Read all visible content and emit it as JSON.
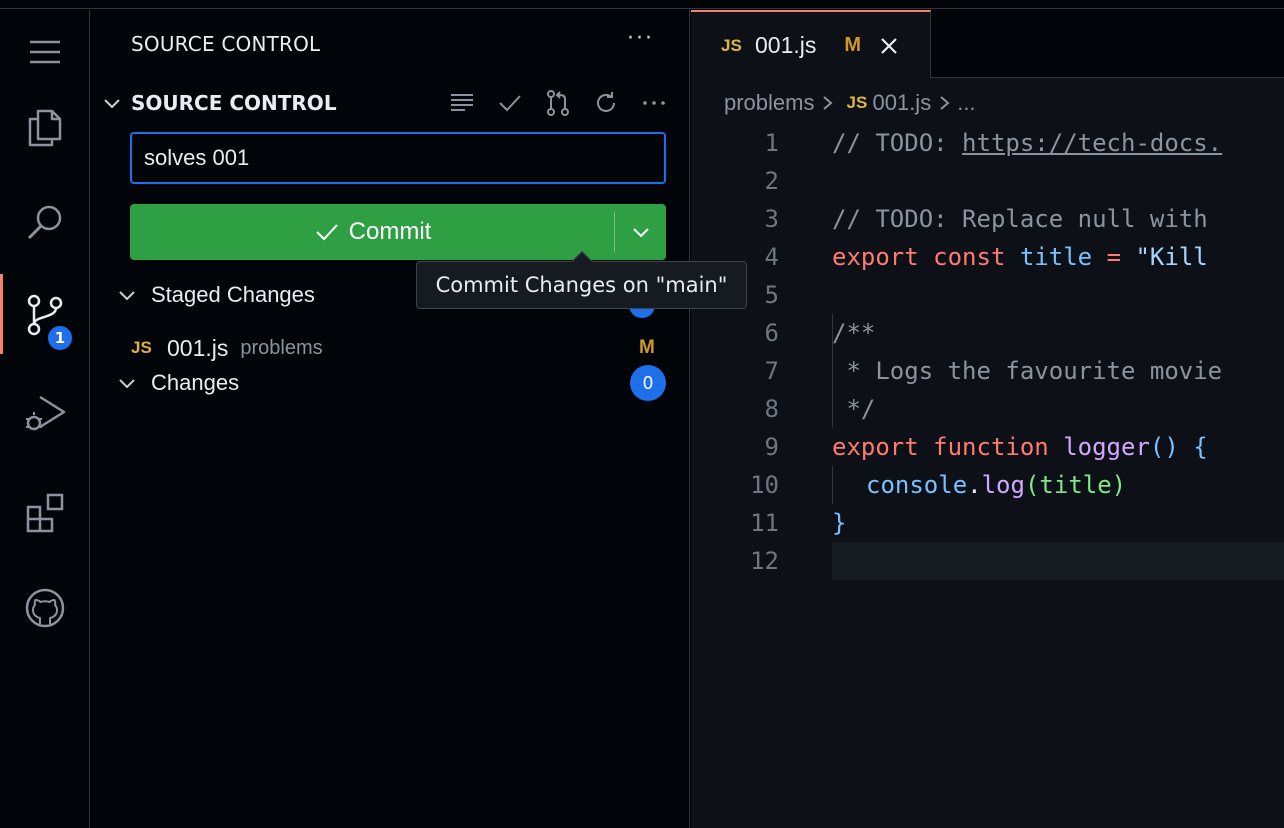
{
  "sidebar": {
    "title": "SOURCE CONTROL",
    "more": "···",
    "section_header": "SOURCE CONTROL",
    "commit_message": "solves 001",
    "commit_label": "Commit",
    "tooltip": "Commit Changes on \"main\"",
    "staged_label": "Staged Changes",
    "changes_label": "Changes",
    "changes_count": "0",
    "staged_file": {
      "icon": "JS",
      "name": "001.js",
      "dir": "problems",
      "status": "M"
    }
  },
  "activity": {
    "source_control_badge": "1"
  },
  "editor": {
    "tab": {
      "icon": "JS",
      "name": "001.js",
      "modified": "M"
    },
    "breadcrumb": {
      "folder": "problems",
      "icon": "JS",
      "file": "001.js",
      "more": "..."
    },
    "lines": [
      {
        "n": "1"
      },
      {
        "n": "2"
      },
      {
        "n": "3"
      },
      {
        "n": "4"
      },
      {
        "n": "5"
      },
      {
        "n": "6"
      },
      {
        "n": "7"
      },
      {
        "n": "8"
      },
      {
        "n": "9"
      },
      {
        "n": "10"
      },
      {
        "n": "11"
      },
      {
        "n": "12"
      }
    ],
    "code": {
      "l1_comment": "// TODO: ",
      "l1_url": "https://tech-docs.",
      "l3": "// TODO: Replace null with",
      "l4_export": "export",
      "l4_const": "const",
      "l4_name": "title",
      "l4_eq": "=",
      "l4_str": "\"Kill",
      "l6": "/**",
      "l7": " * Logs the favourite movie",
      "l8": " */",
      "l9_export": "export",
      "l9_function": "function",
      "l9_name": "logger",
      "l9_rest": "() {",
      "l10_obj": "console",
      "l10_dot": ".",
      "l10_fn": "log",
      "l10_arg": "(title)",
      "l11": "}"
    }
  },
  "colors": {
    "accent": "#1f6feb",
    "commit_green": "#2ea043",
    "modified": "#d29922",
    "js_yellow": "#e3b341"
  }
}
